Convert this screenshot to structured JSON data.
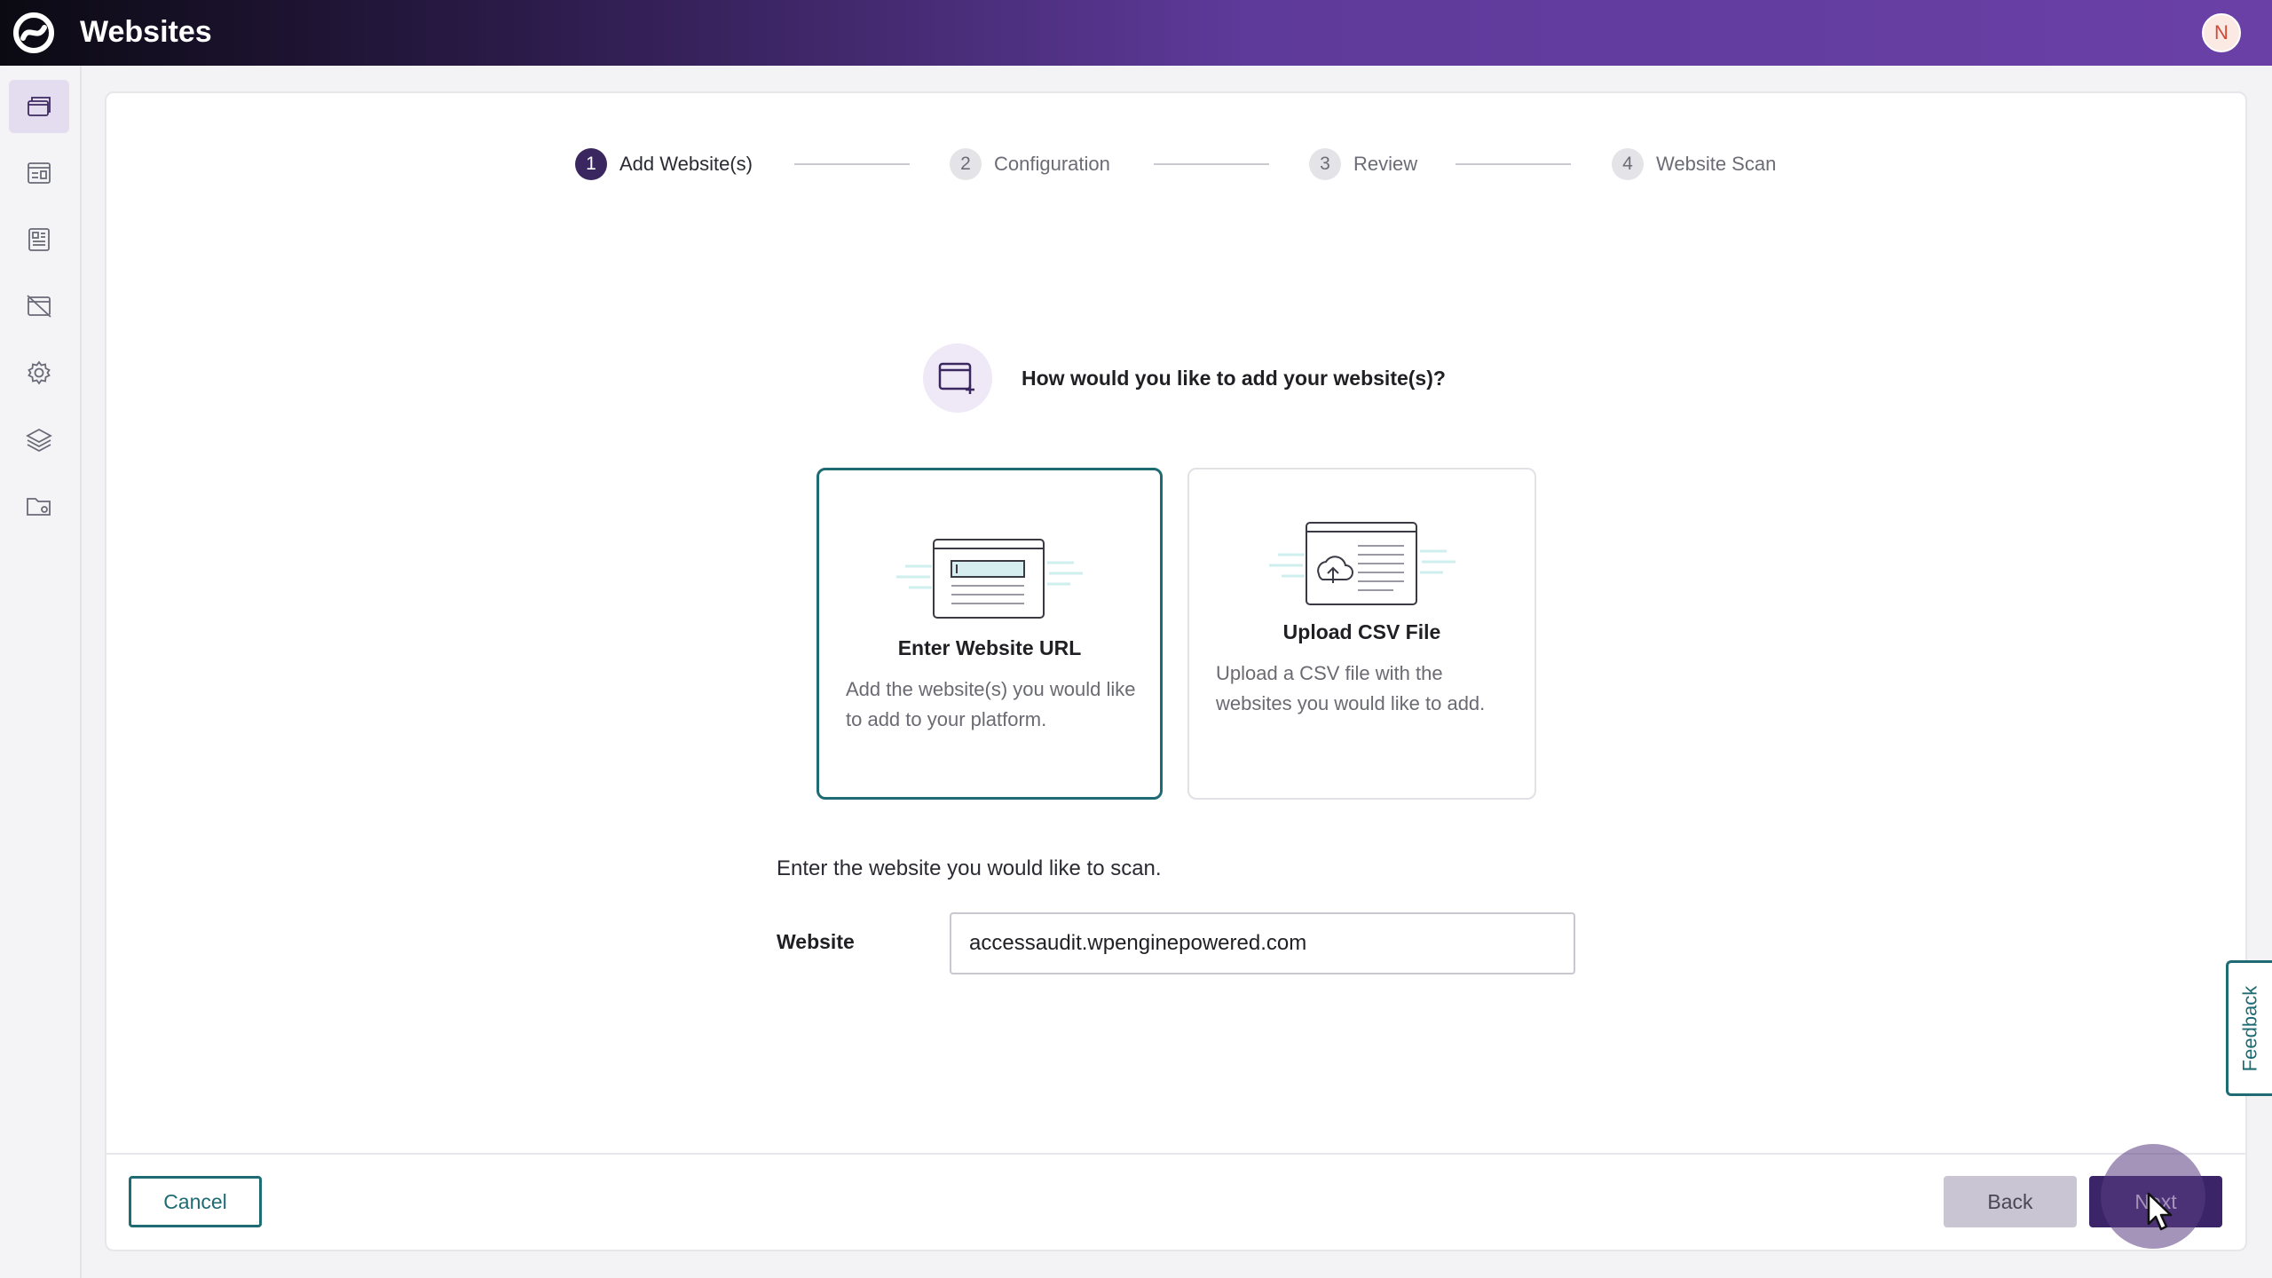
{
  "app": {
    "title": "Websites",
    "avatar_initial": "N"
  },
  "sidebar": {
    "items": [
      {
        "name": "websites",
        "icon": "browser-windows-icon",
        "active": true
      },
      {
        "name": "dashboard",
        "icon": "dashboard-card-icon",
        "active": false
      },
      {
        "name": "reports",
        "icon": "report-document-icon",
        "active": false
      },
      {
        "name": "issues",
        "icon": "crossed-window-icon",
        "active": false
      },
      {
        "name": "settings",
        "icon": "gear-icon",
        "active": false
      },
      {
        "name": "layers",
        "icon": "layers-icon",
        "active": false
      },
      {
        "name": "folders",
        "icon": "folder-settings-icon",
        "active": false
      }
    ]
  },
  "stepper": {
    "steps": [
      {
        "number": "1",
        "label": "Add Website(s)",
        "active": true
      },
      {
        "number": "2",
        "label": "Configuration",
        "active": false
      },
      {
        "number": "3",
        "label": "Review",
        "active": false
      },
      {
        "number": "4",
        "label": "Website Scan",
        "active": false
      }
    ]
  },
  "question": {
    "text": "How would you like to add your website(s)?"
  },
  "options": [
    {
      "title": "Enter Website URL",
      "description": "Add the website(s) you would like to add to your platform.",
      "selected": true
    },
    {
      "title": "Upload CSV File",
      "description": "Upload a CSV file with the websites you would like to add.",
      "selected": false
    }
  ],
  "form": {
    "prompt": "Enter the website you would like to scan.",
    "website_label": "Website",
    "website_value": "accessaudit.wpenginepowered.com"
  },
  "footer": {
    "cancel_label": "Cancel",
    "back_label": "Back",
    "next_label": "Next"
  },
  "feedback": {
    "label": "Feedback"
  },
  "colors": {
    "primary": "#3b2568",
    "accent": "#1e6b73",
    "header_gradient_end": "#6a40a6"
  }
}
